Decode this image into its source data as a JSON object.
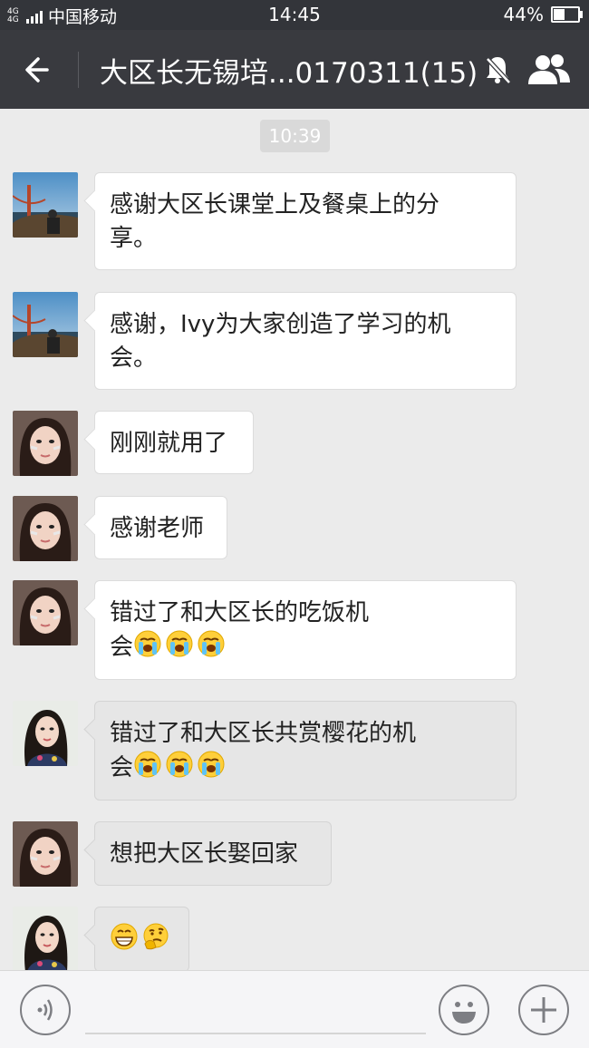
{
  "status_bar": {
    "network": "4G 4G",
    "carrier": "中国移动",
    "time": "14:45",
    "battery_text": "44%",
    "battery_level": 0.44
  },
  "nav": {
    "title": "大区长无锡培...0170311(15)",
    "back_icon": "back-arrow-icon",
    "mute_icon": "bell-off-icon",
    "members_icon": "group-members-icon"
  },
  "chat": {
    "timestamp": "10:39",
    "messages": [
      {
        "sender_avatar": "avatar-landscape",
        "line1": "感谢大区长课堂上及餐桌上的分",
        "line2": "享。",
        "style": "white"
      },
      {
        "sender_avatar": "avatar-landscape",
        "line1": "感谢，Ivy为大家创造了学习的机",
        "line2": "会。",
        "style": "white"
      },
      {
        "sender_avatar": "avatar-girl",
        "line1": "刚刚就用了",
        "style": "white"
      },
      {
        "sender_avatar": "avatar-girl",
        "line1": "感谢老师",
        "style": "white"
      },
      {
        "sender_avatar": "avatar-girl",
        "line1": "错过了和大区长的吃饭机",
        "line2": "会",
        "emojis": [
          "crying-face",
          "crying-face",
          "crying-face"
        ],
        "style": "white"
      },
      {
        "sender_avatar": "avatar-woman",
        "line1": "错过了和大区长共赏樱花的机",
        "line2": "会",
        "emojis": [
          "crying-face",
          "crying-face",
          "crying-face"
        ],
        "style": "grey"
      },
      {
        "sender_avatar": "avatar-girl",
        "line1": "想把大区长娶回家",
        "style": "grey"
      },
      {
        "sender_avatar": "avatar-woman",
        "emojis": [
          "grinning-face",
          "thinking-face"
        ],
        "style": "grey"
      }
    ]
  },
  "input_bar": {
    "voice_icon": "voice-icon",
    "emoji_icon": "smiley-icon",
    "more_icon": "plus-icon"
  },
  "colors": {
    "status_bg": "#33353a",
    "nav_bg": "#393a3f",
    "chat_bg": "#ebebeb",
    "bubble_white": "#ffffff",
    "bubble_grey": "#e6e6e6"
  }
}
